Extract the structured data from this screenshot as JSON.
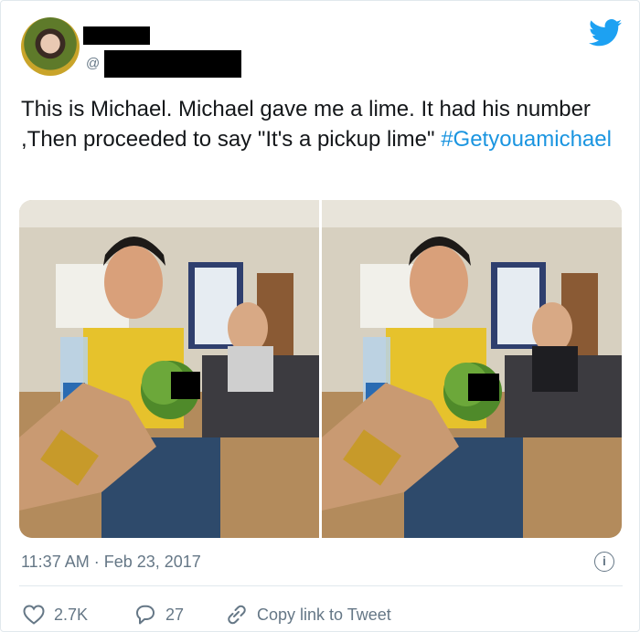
{
  "tweet": {
    "handle_prefix": "@",
    "text": "This is Michael. Michael gave me a lime. It had his number ,Then proceeded to say \"It's a pickup lime\" ",
    "hashtag": "#Getyouamichael",
    "timestamp": "11:37 AM · Feb 23, 2017"
  },
  "actions": {
    "likes": "2.7K",
    "replies": "27",
    "copy_link": "Copy link to Tweet"
  },
  "icons": {
    "brand": "twitter-bird-icon",
    "info": "info-icon",
    "like": "heart-icon",
    "reply": "speech-bubble-icon",
    "link": "link-icon"
  },
  "colors": {
    "brand": "#1da1f2",
    "hashtag": "#1b95e0",
    "secondary_text": "#657786"
  }
}
